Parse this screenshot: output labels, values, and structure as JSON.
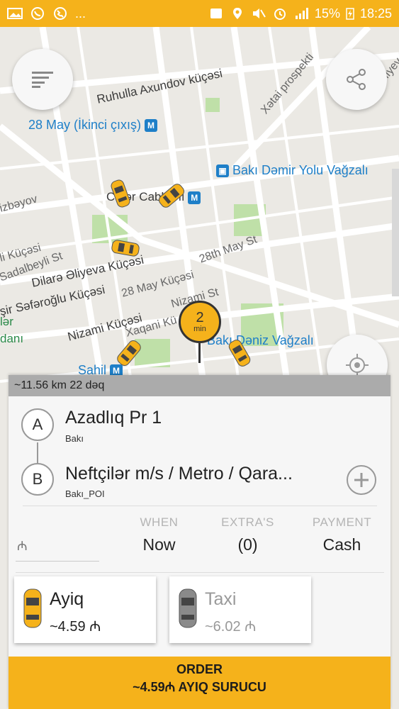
{
  "statusbar": {
    "ellipsis": "...",
    "battery": "15%",
    "time": "18:25",
    "icons_left": [
      "image-icon",
      "whatsapp-icon",
      "call-icon"
    ],
    "icons_right": [
      "wallet-icon",
      "location-icon",
      "mute-icon",
      "alarm-icon",
      "signal-icon",
      "charging-icon"
    ]
  },
  "map": {
    "labels": {
      "ruhulla": "Ruhulla Axundov küçəsi",
      "may28_exit": "28 May (İkinci çıxış)",
      "xatai": "Xətai prospekti",
      "quliyev": "Quliyev",
      "damir": "Bakı Dəmir Yolu Vağzalı",
      "cafar": "Cəfər Cabbarlı",
      "izbeyov": "izbəyov",
      "li_kucesi": "li Küçəsi",
      "sadalbeyli": "Sadalbeyli St",
      "dilara": "Dilarə Əliyeva Küçəsi",
      "may28_kucesi": "28 May Küçəsi",
      "may28th_st": "28th May St",
      "sir": "şir Səfəroğlu Küçəsi",
      "nizami_st": "Nizami St",
      "nizami_kucesi": "Nizami Küçəsi",
      "xagani": "Xaqani Kü",
      "lar": "lər",
      "dani": "danı",
      "deniz": "Bakı Dəniz Vağzalı",
      "sahil": "Sahil"
    },
    "eta_value": "2",
    "eta_unit": "min",
    "road_color": "#ffffff",
    "park_color": "#bfe0a8",
    "car_color": "#f5b21b"
  },
  "buttons": {
    "menu_icon": "menu-icon",
    "share_icon": "share-icon",
    "locate_icon": "crosshair-icon"
  },
  "panel": {
    "distance": "~11.56 km 22 dəq",
    "pickup": {
      "marker": "A",
      "address": "Azadlıq Pr 1",
      "city": "Bakı"
    },
    "dropoff": {
      "marker": "B",
      "address": "Neftçilər m/s / Metro / Qara...",
      "city": "Bakı_POI"
    },
    "add_icon": "plus-circle-icon",
    "currency_symbol": "₼",
    "options": [
      {
        "header": "WHEN",
        "value": "Now"
      },
      {
        "header": "EXTRA'S",
        "value": "(0)"
      },
      {
        "header": "PAYMENT",
        "value": "Cash"
      }
    ],
    "tariffs": [
      {
        "name": "Ayiq",
        "fare": "~4.59 ₼",
        "selected": true
      },
      {
        "name": "Taxi",
        "fare": "~6.02 ₼",
        "selected": false
      }
    ],
    "order": {
      "line1": "ORDER",
      "line2": "~4.59₼ AYIQ SURUCU"
    }
  },
  "colors": {
    "accent": "#f5b21b",
    "panel_bg": "#f6f6f6",
    "distance_bar": "#ababab"
  }
}
